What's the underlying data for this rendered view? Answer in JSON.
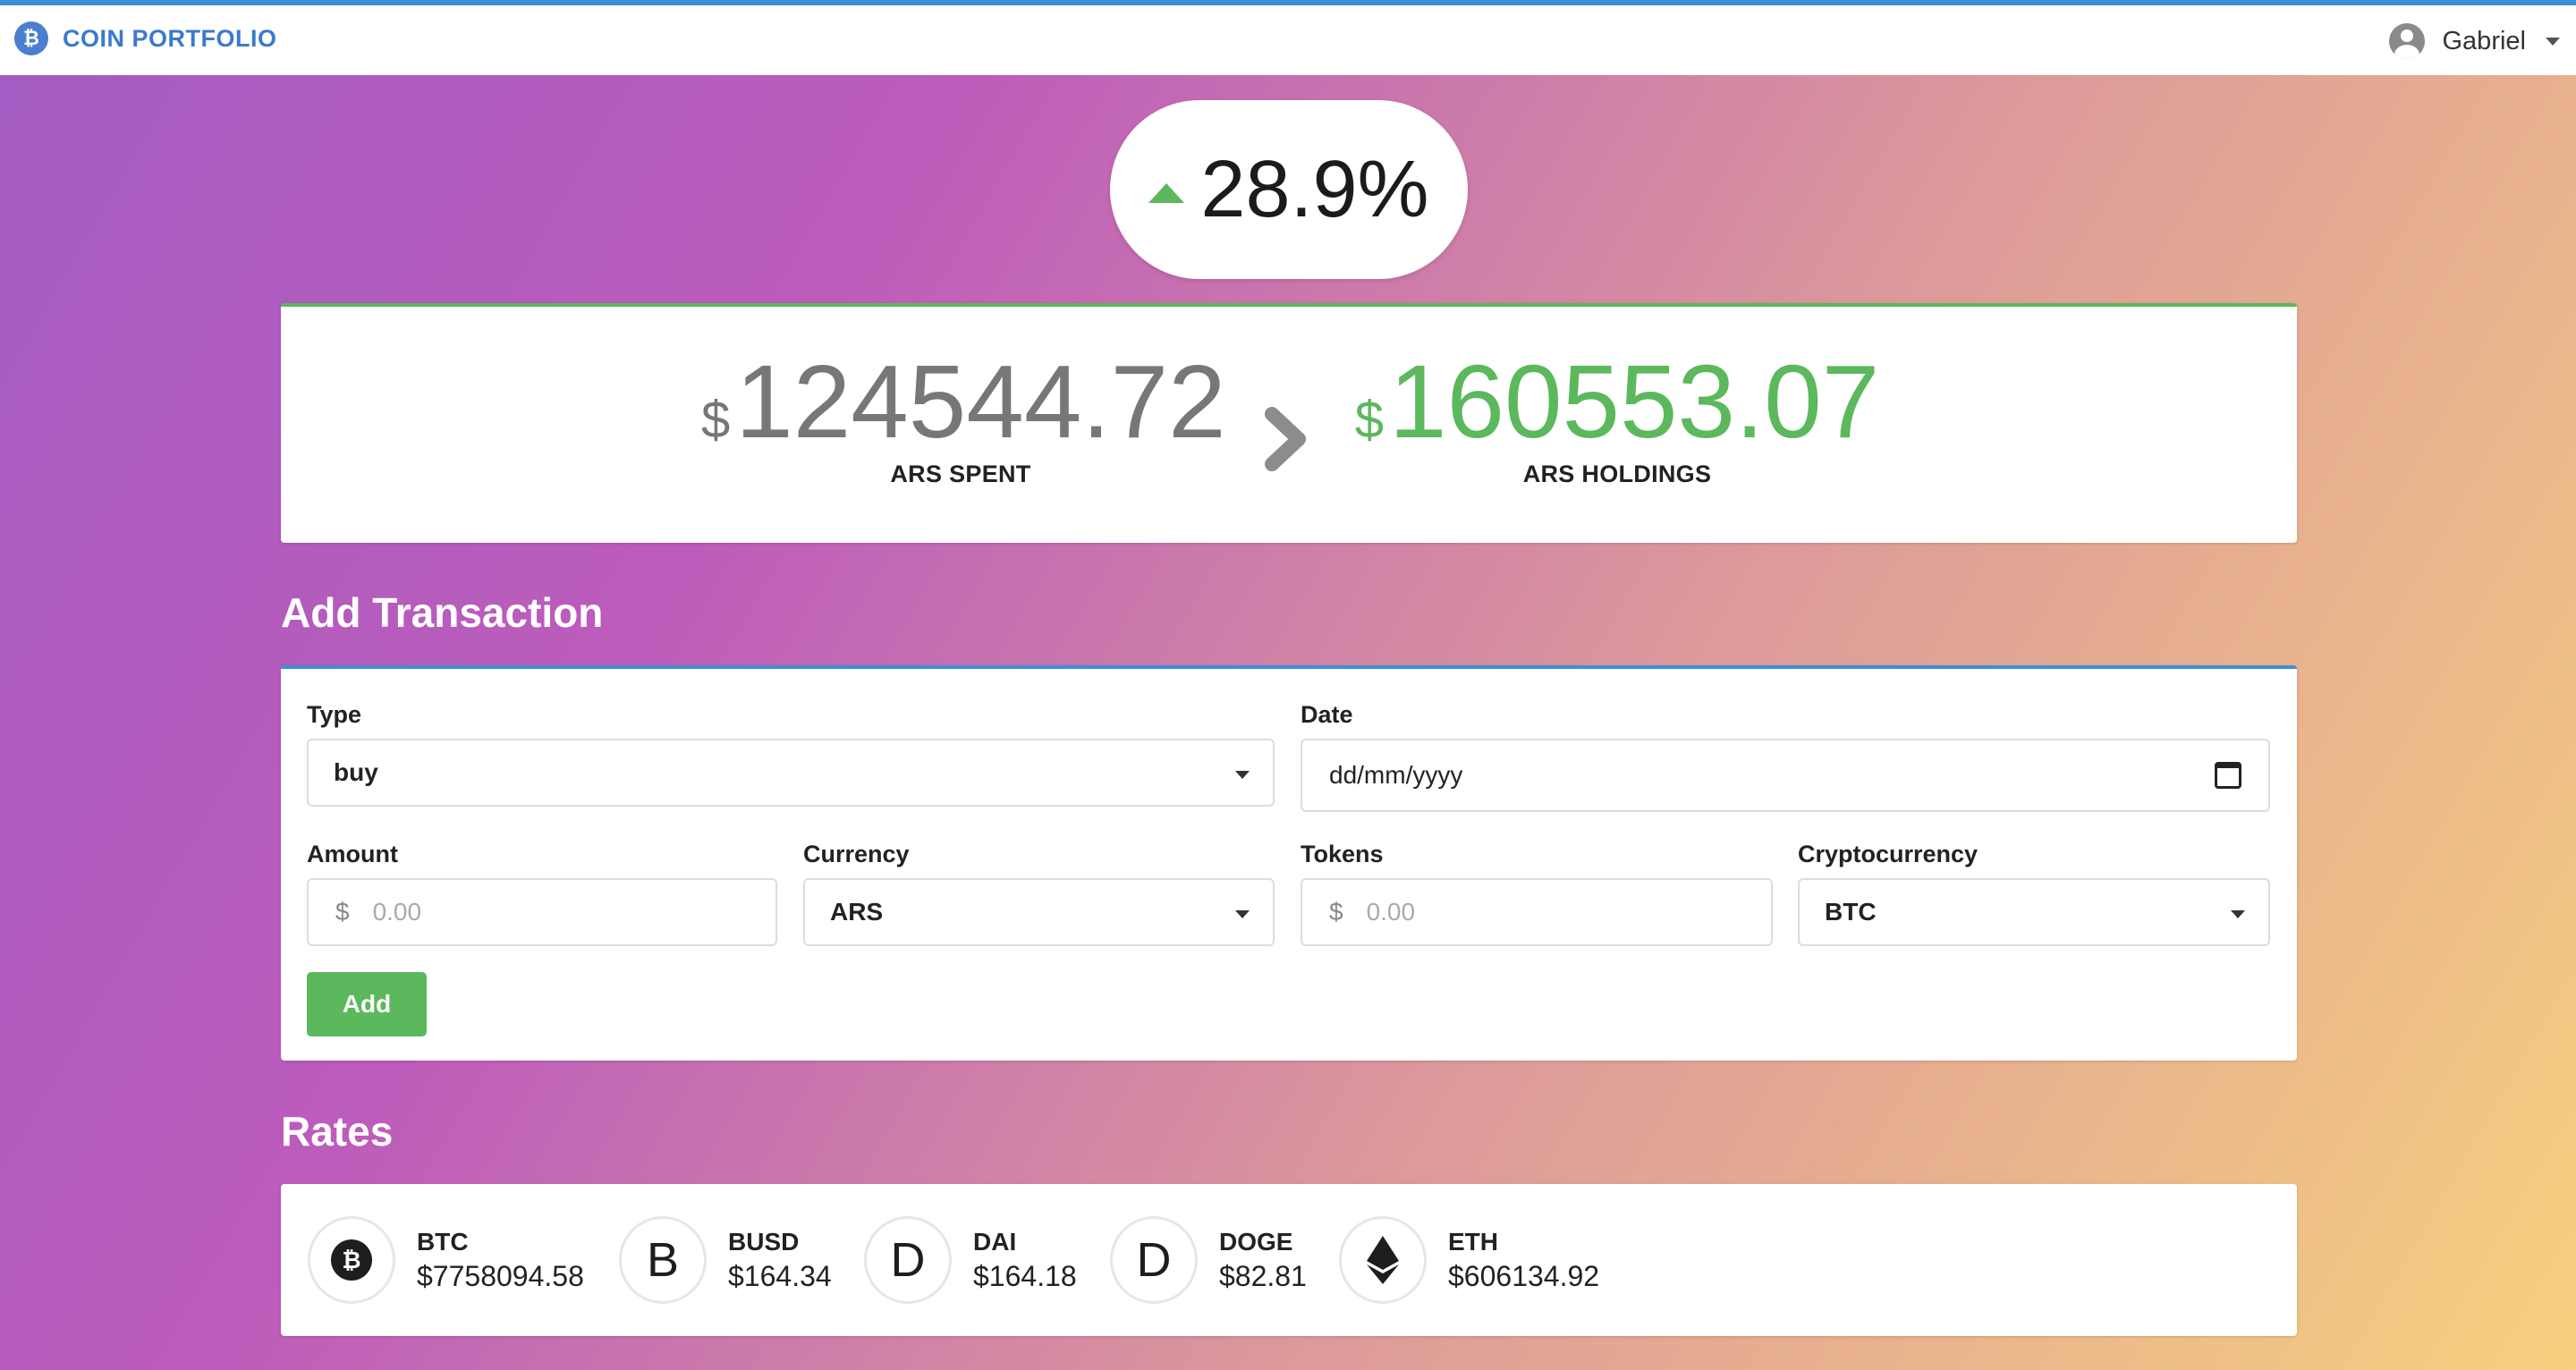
{
  "app": {
    "brand_name": "COIN PORTFOLIO",
    "brand_icon": "bitcoin-icon",
    "user_name": "Gabriel"
  },
  "performance": {
    "change": "28.9%",
    "direction": "up"
  },
  "summary": {
    "spent_currency_symbol": "$",
    "spent_value": "124544.72",
    "spent_label": "ARS SPENT",
    "holdings_currency_symbol": "$",
    "holdings_value": "160553.07",
    "holdings_label": "ARS HOLDINGS"
  },
  "add_transaction": {
    "title": "Add Transaction",
    "type_label": "Type",
    "type_value": "buy",
    "date_label": "Date",
    "date_placeholder": "dd/mm/yyyy",
    "amount_label": "Amount",
    "amount_prefix": "$",
    "amount_placeholder": "0.00",
    "currency_label": "Currency",
    "currency_value": "ARS",
    "tokens_label": "Tokens",
    "tokens_prefix": "$",
    "tokens_placeholder": "0.00",
    "crypto_label": "Cryptocurrency",
    "crypto_value": "BTC",
    "add_label": "Add"
  },
  "rates": {
    "title": "Rates",
    "items": [
      {
        "symbol": "BTC",
        "value": "$7758094.58",
        "icon": "bitcoin-icon"
      },
      {
        "symbol": "BUSD",
        "value": "$164.34",
        "icon_letter": "B"
      },
      {
        "symbol": "DAI",
        "value": "$164.18",
        "icon_letter": "D"
      },
      {
        "symbol": "DOGE",
        "value": "$82.81",
        "icon_letter": "D"
      },
      {
        "symbol": "ETH",
        "value": "$606134.92",
        "icon": "ethereum-icon"
      }
    ]
  },
  "colors": {
    "accent_blue": "#3d8fd6",
    "positive_green": "#5cb85c",
    "spent_gray": "#777777"
  }
}
